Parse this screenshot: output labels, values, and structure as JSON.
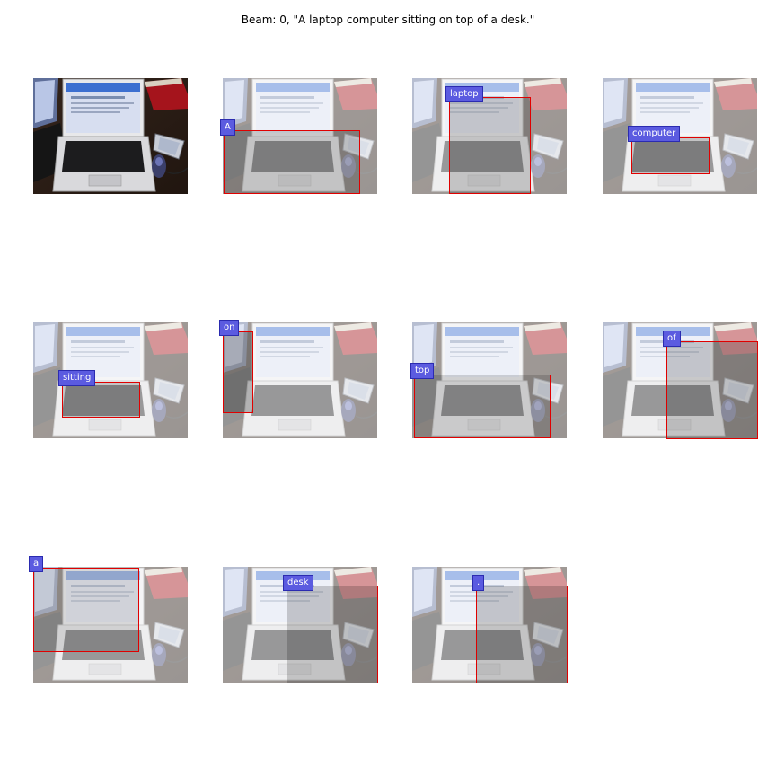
{
  "title": "Beam: 0, \"A laptop computer sitting on top of a desk.\"",
  "words": [
    "A",
    "laptop",
    "computer",
    "sitting",
    "on",
    "top",
    "of",
    "a",
    "desk",
    "."
  ]
}
